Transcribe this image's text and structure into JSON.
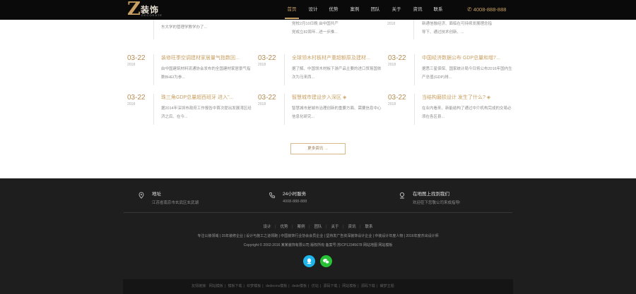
{
  "header": {
    "logo_letter": "Z",
    "logo_text": "装饰",
    "logo_sub": "DECORATE",
    "nav": [
      "首页",
      "设计",
      "优势",
      "案例",
      "团队",
      "关于",
      "资讯",
      "联系"
    ],
    "active_index": 0,
    "phone": "4008-888-888"
  },
  "top_partial": [
    {
      "desc_1": "东大学的管理学教学办了...",
      "desc_2": "党校2月10日晚 由中国共产",
      "desc_3": "党成立82周年...进一步推..."
    },
    {
      "year": "2018",
      "desc_1": "新通信融经济、面临在可持续发展理念指",
      "desc_2": "导下、通过技术创新、..."
    }
  ],
  "news": [
    {
      "date": "03-22",
      "year": "2018",
      "title": "装修旺季空调建材家居量气指数回...",
      "desc": "由中国建筑材料流通协会发布的全国建材家居景气指数BHEI为参..."
    },
    {
      "date": "03-22",
      "year": "2018",
      "title": "全球领木村板材产重超额原及建材...",
      "desc": "据了解、中国领木材板下游产品主要的进口贸易国依次为马来西..."
    },
    {
      "date": "03-22",
      "year": "2018",
      "title": "中国经济数据公布 GDP总量和增7...",
      "desc": "据悉三星保保、国家统计局今日将公布2016年国内生产总值(GDP)排..."
    },
    {
      "date": "03-22",
      "year": "2018",
      "title": "珠三角GDP总量超西班牙 进入\"...",
      "desc": "据2014年深圳市政府工作报告中首次提出发展湾区经济之后、在今..."
    },
    {
      "date": "03-22",
      "year": "2018",
      "title": "智慧城市建设步入深区 ◈",
      "desc": "智慧城市是城市治理创新的重要方面、需要信息中心信息化研究..."
    },
    {
      "date": "03-22",
      "year": "2018",
      "title": "当结构磨损设计 发生了什么? ◈",
      "desc": "在业内看来、新能结构了通过中介机构完成的交易必须在各区县..."
    }
  ],
  "more_label": "更多资讯",
  "more_arrow": "→",
  "footer": {
    "contacts": [
      {
        "icon": "location-icon",
        "title": "地址",
        "sub": "江苏省南京市玄武区玄武湖"
      },
      {
        "icon": "phone-icon",
        "title": "24小时服务",
        "sub": "4008-888-888"
      },
      {
        "icon": "map-pin-icon",
        "title": "在地图上找到我们",
        "sub": "欢迎莅下您敬公司来成指导!"
      }
    ],
    "nav": [
      "设计",
      "优势",
      "案例",
      "团队",
      "关于",
      "资讯",
      "联系"
    ],
    "tags": "专注公装领域 | 15年装修企业 | 设计与施工之道领跑 | 中国装饰行业协会会员企业 | 坚持发广告资深装饰设计企业 | 中装设计年度人物 | 2016年度杰出设计师",
    "copyright": "Copyright © 2002-2016 某某装饰有限公司 版权所有 备案号:苏ICP12345678 网站地图 网站模板",
    "links_label": "友情链接:",
    "links": [
      "网站模板",
      "模板下载",
      "织梦模板",
      "dedecms模板",
      "dede模板",
      "仿站",
      "源码下载",
      "网站模板",
      "源码下载",
      "織梦主题"
    ]
  },
  "colors": {
    "accent": "#c9a063",
    "header_bg": "#0a0a0a",
    "footer_bg": "#1e1e1e",
    "qq": "#1fb5ea",
    "wechat": "#29c237"
  }
}
